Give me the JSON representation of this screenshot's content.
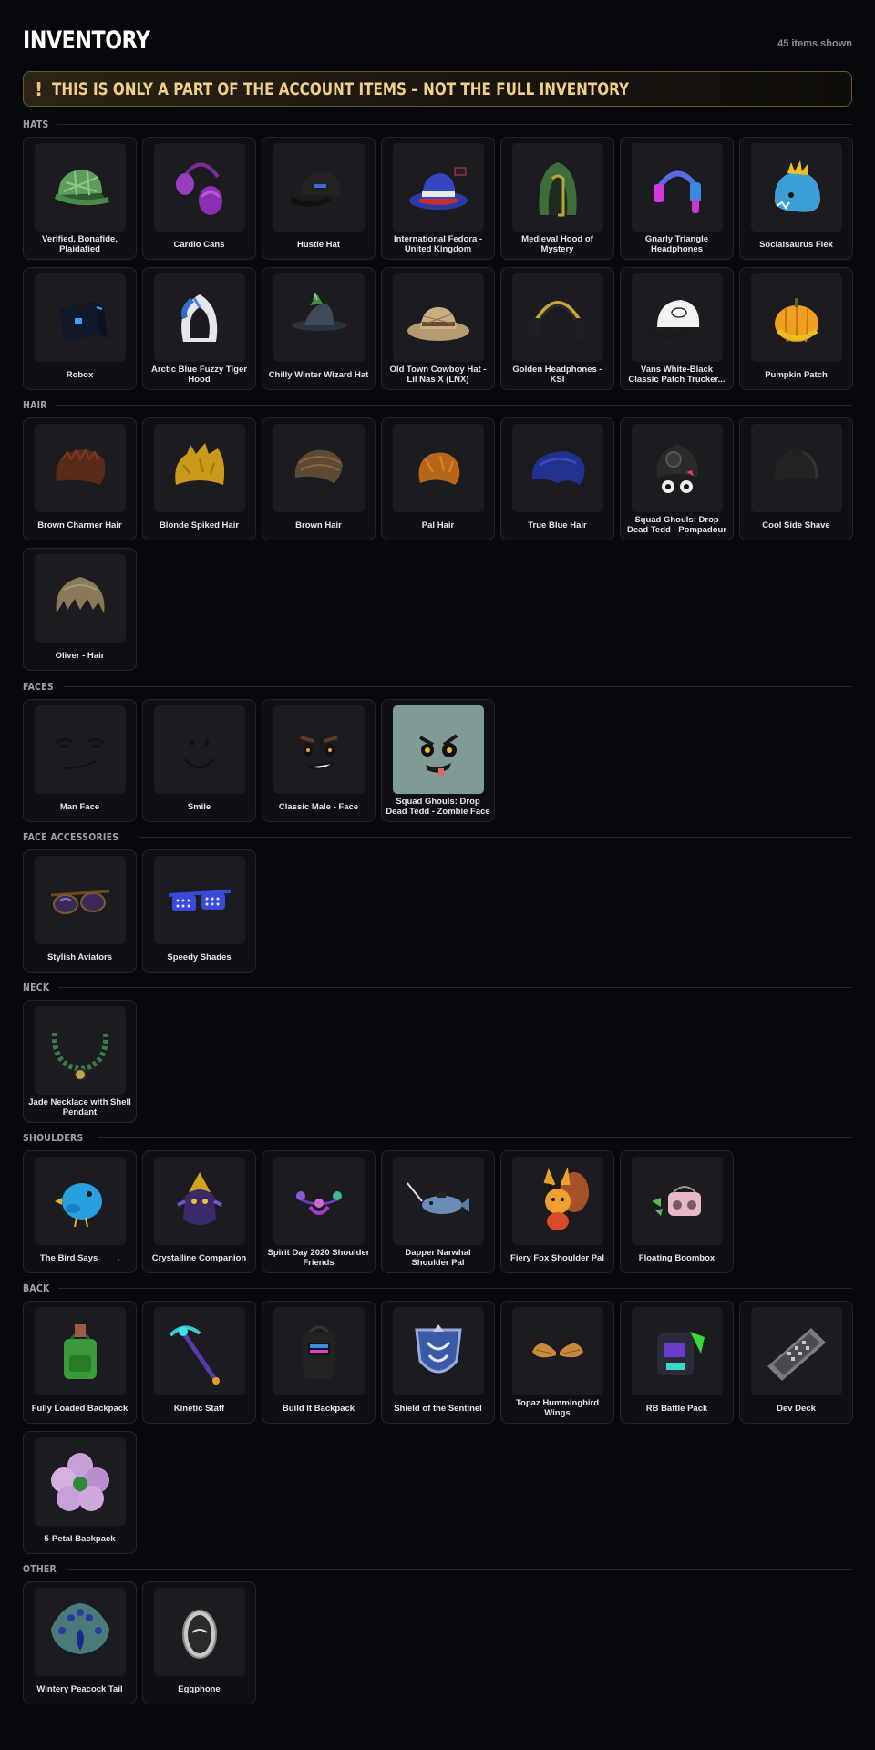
{
  "title": "INVENTORY",
  "count": "45 items shown",
  "banner": {
    "icon": "!",
    "text": "THIS IS ONLY A PART OF THE ACCOUNT ITEMS – NOT THE FULL INVENTORY"
  },
  "sections": [
    {
      "label": "HATS",
      "items": [
        {
          "name": "Verified, Bonafide, Plaidafied",
          "icon": "plaid-cap"
        },
        {
          "name": "Cardio Cans",
          "icon": "purple-earmuffs"
        },
        {
          "name": "Hustle Hat",
          "icon": "black-cap"
        },
        {
          "name": "International Fedora - United Kingdom",
          "icon": "blue-fedora"
        },
        {
          "name": "Medieval Hood of Mystery",
          "icon": "green-hood"
        },
        {
          "name": "Gnarly Triangle Headphones",
          "icon": "pink-blue-headphones"
        },
        {
          "name": "Socialsaurus Flex",
          "icon": "dino-hat"
        },
        {
          "name": "Robox",
          "icon": "robox-head"
        },
        {
          "name": "Arctic Blue Fuzzy Tiger Hood",
          "icon": "tiger-hood"
        },
        {
          "name": "Chilly Winter Wizard Hat",
          "icon": "wizard-hat"
        },
        {
          "name": "Old Town Cowboy Hat - Lil Nas X (LNX)",
          "icon": "cowboy-hat"
        },
        {
          "name": "Golden Headphones - KSI",
          "icon": "golden-headphones"
        },
        {
          "name": "Vans White-Black Classic Patch Trucker...",
          "icon": "trucker-cap"
        },
        {
          "name": "Pumpkin Patch",
          "icon": "pumpkin-hat"
        }
      ]
    },
    {
      "label": "HAIR",
      "items": [
        {
          "name": "Brown Charmer Hair",
          "icon": "brown-hair"
        },
        {
          "name": "Blonde Spiked Hair",
          "icon": "blonde-hair"
        },
        {
          "name": "Brown Hair",
          "icon": "brown-swept-hair"
        },
        {
          "name": "Pal Hair",
          "icon": "orange-hair"
        },
        {
          "name": "True Blue Hair",
          "icon": "blue-hair"
        },
        {
          "name": "Squad Ghouls: Drop Dead Tedd - Pompadour",
          "icon": "pompadour-hair"
        },
        {
          "name": "Cool Side Shave",
          "icon": "side-shave-hair"
        },
        {
          "name": "Oliver - Hair",
          "icon": "oliver-hair"
        }
      ]
    },
    {
      "label": "FACES",
      "items": [
        {
          "name": "Man Face",
          "icon": "man-face"
        },
        {
          "name": "Smile",
          "icon": "smile-face"
        },
        {
          "name": "Classic Male - Face",
          "icon": "classic-male-face"
        },
        {
          "name": "Squad Ghouls: Drop Dead Tedd - Zombie Face",
          "icon": "zombie-face"
        }
      ]
    },
    {
      "label": "FACE ACCESSORIES",
      "items": [
        {
          "name": "Stylish Aviators",
          "icon": "aviators"
        },
        {
          "name": "Speedy Shades",
          "icon": "speedy-shades"
        }
      ]
    },
    {
      "label": "NECK",
      "items": [
        {
          "name": "Jade Necklace with Shell Pendant",
          "icon": "jade-necklace"
        }
      ]
    },
    {
      "label": "SHOULDERS",
      "items": [
        {
          "name": "The Bird Says____.",
          "icon": "blue-bird"
        },
        {
          "name": "Crystalline Companion",
          "icon": "crystal-companion"
        },
        {
          "name": "Spirit Day 2020 Shoulder Friends",
          "icon": "shoulder-friends"
        },
        {
          "name": "Dapper Narwhal Shoulder Pal",
          "icon": "narwhal"
        },
        {
          "name": "Fiery Fox Shoulder Pal",
          "icon": "fire-fox"
        },
        {
          "name": "Floating Boombox",
          "icon": "boombox"
        }
      ]
    },
    {
      "label": "BACK",
      "items": [
        {
          "name": "Fully Loaded Backpack",
          "icon": "green-backpack"
        },
        {
          "name": "Kinetic Staff",
          "icon": "staff"
        },
        {
          "name": "Build It Backpack",
          "icon": "black-backpack"
        },
        {
          "name": "Shield of the Sentinel",
          "icon": "shield"
        },
        {
          "name": "Topaz Hummingbird Wings",
          "icon": "wings"
        },
        {
          "name": "RB Battle Pack",
          "icon": "battle-pack"
        },
        {
          "name": "Dev Deck",
          "icon": "dev-deck"
        },
        {
          "name": "5-Petal Backpack",
          "icon": "flower-backpack"
        }
      ]
    },
    {
      "label": "OTHER",
      "items": [
        {
          "name": "Wintery Peacock Tail",
          "icon": "peacock-tail"
        },
        {
          "name": "Eggphone",
          "icon": "eggphone"
        }
      ]
    }
  ]
}
